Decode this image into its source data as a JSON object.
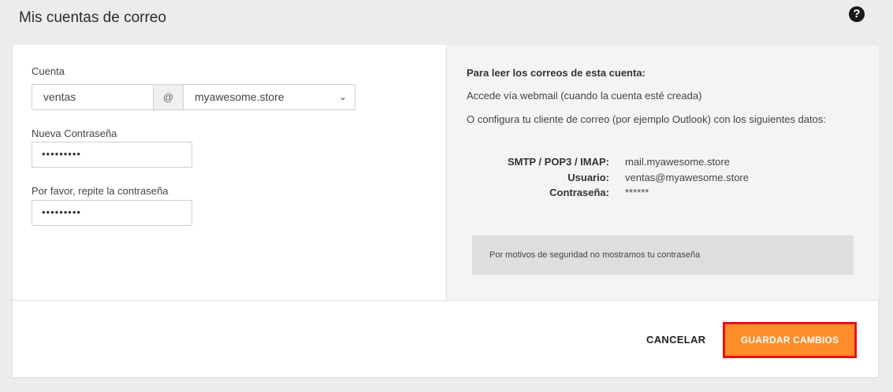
{
  "page": {
    "title": "Mis cuentas de correo",
    "help_icon": "?"
  },
  "form": {
    "account_label": "Cuenta",
    "account_user": "ventas",
    "at_symbol": "@",
    "domain_selected": "myawesome.store",
    "new_password_label": "Nueva Contraseña",
    "new_password_value": "•••••••••",
    "repeat_password_label": "Por favor, repite la contraseña",
    "repeat_password_value": "•••••••••"
  },
  "info": {
    "heading": "Para leer los correos de esta cuenta:",
    "webmail_line": "Accede vía webmail (cuando la cuenta esté creada)",
    "client_line": "O configura tu cliente de correo (por ejemplo Outlook) con los siguientes datos:",
    "server_label": "SMTP / POP3 / IMAP:",
    "server_value": "mail.myawesome.store",
    "user_label": "Usuario:",
    "user_value": "ventas@myawesome.store",
    "password_label": "Contraseña:",
    "password_value": "******",
    "security_notice": "Por motivos de seguridad no mostramos tu contraseña"
  },
  "footer": {
    "cancel_label": "CANCELAR",
    "save_label": "GUARDAR CAMBIOS"
  },
  "colors": {
    "accent": "#ff8c2a",
    "highlight_border": "#e8111a"
  }
}
